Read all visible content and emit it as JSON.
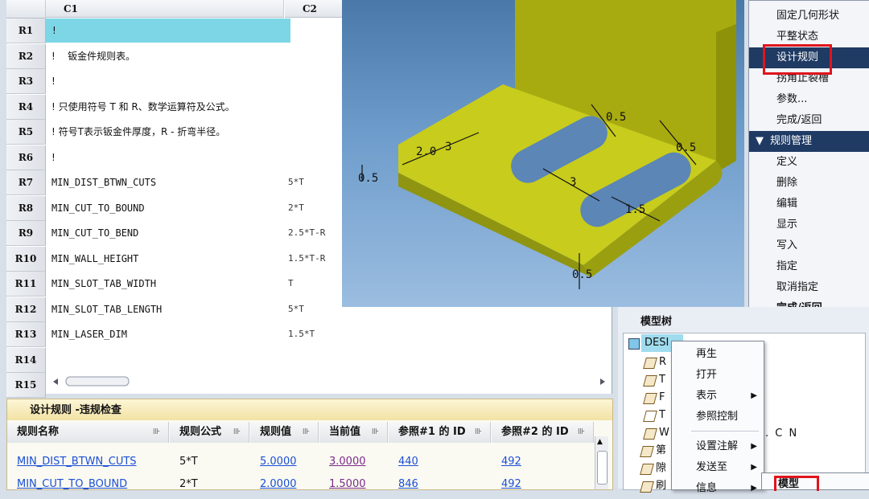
{
  "sheet": {
    "columns": [
      "C1",
      "C2"
    ],
    "rows": [
      {
        "id": "R1",
        "c1": "!",
        "c2": ""
      },
      {
        "id": "R2",
        "c1": "!    钣金件规则表。",
        "c2": ""
      },
      {
        "id": "R3",
        "c1": "!",
        "c2": ""
      },
      {
        "id": "R4",
        "c1": "! 只使用符号 T 和 R、数学运算符及公式。",
        "c2": ""
      },
      {
        "id": "R5",
        "c1": "! 符号T表示钣金件厚度，R - 折弯半径。",
        "c2": ""
      },
      {
        "id": "R6",
        "c1": "!",
        "c2": ""
      },
      {
        "id": "R7",
        "c1": "MIN_DIST_BTWN_CUTS",
        "c2": "5*T"
      },
      {
        "id": "R8",
        "c1": "MIN_CUT_TO_BOUND",
        "c2": "2*T"
      },
      {
        "id": "R9",
        "c1": "MIN_CUT_TO_BEND",
        "c2": "2.5*T-R"
      },
      {
        "id": "R10",
        "c1": "MIN_WALL_HEIGHT",
        "c2": "1.5*T-R"
      },
      {
        "id": "R11",
        "c1": "MIN_SLOT_TAB_WIDTH",
        "c2": "T"
      },
      {
        "id": "R12",
        "c1": "MIN_SLOT_TAB_LENGTH",
        "c2": "5*T"
      },
      {
        "id": "R13",
        "c1": "MIN_LASER_DIM",
        "c2": "1.5*T"
      },
      {
        "id": "R14",
        "c1": "",
        "c2": ""
      },
      {
        "id": "R15",
        "c1": "",
        "c2": ""
      }
    ]
  },
  "view3d": {
    "dims": [
      "2.0",
      "3",
      "0.5",
      "0.5",
      "3",
      "1.5",
      "0.5",
      "0.5"
    ]
  },
  "menu": {
    "items": [
      {
        "label": "固定几何形状",
        "type": "item"
      },
      {
        "label": "平整状态",
        "type": "item"
      },
      {
        "label": "设计规则",
        "type": "selected"
      },
      {
        "label": "拐角止裂槽",
        "type": "item"
      },
      {
        "label": "参数...",
        "type": "item"
      },
      {
        "label": "完成/返回",
        "type": "item"
      },
      {
        "label": "规则管理",
        "type": "header"
      },
      {
        "label": "定义",
        "type": "item"
      },
      {
        "label": "删除",
        "type": "item"
      },
      {
        "label": "编辑",
        "type": "item"
      },
      {
        "label": "显示",
        "type": "item"
      },
      {
        "label": "写入",
        "type": "item"
      },
      {
        "label": "指定",
        "type": "item"
      },
      {
        "label": "取消指定",
        "type": "item"
      },
      {
        "label": "完成/返回",
        "type": "bold"
      }
    ]
  },
  "tree": {
    "title": "模型树",
    "root": "DESI",
    "items": [
      "R",
      "T",
      "F",
      "T",
      "W",
      "第",
      "隙",
      "刷"
    ],
    "watermark": ". C N"
  },
  "context_menu": {
    "items": [
      {
        "label": "再生",
        "arrow": false
      },
      {
        "label": "打开",
        "arrow": false
      },
      {
        "label": "表示",
        "arrow": true
      },
      {
        "label": "参照控制",
        "arrow": false
      },
      {
        "label": "设置注解",
        "arrow": true
      },
      {
        "label": "发送至",
        "arrow": true
      },
      {
        "label": "信息",
        "arrow": true
      }
    ],
    "submenu_item": "模型"
  },
  "panel": {
    "title": "设计规则 -违规检查",
    "headers": [
      "规则名称",
      "规则公式",
      "规则值",
      "当前值",
      "参照#1 的 ID",
      "参照#2 的 ID"
    ],
    "rows": [
      [
        "MIN_DIST_BTWN_CUTS",
        "5*T",
        "5.0000",
        "3.0000",
        "440",
        "492"
      ],
      [
        "MIN_CUT_TO_BOUND",
        "2*T",
        "2.0000",
        "1.5000",
        "846",
        "492"
      ]
    ]
  },
  "colors": {
    "highlight": "#7dd6e6",
    "menu_selected": "#1f3a63",
    "callout": "#e0141c",
    "part": "#c8cc1c"
  }
}
